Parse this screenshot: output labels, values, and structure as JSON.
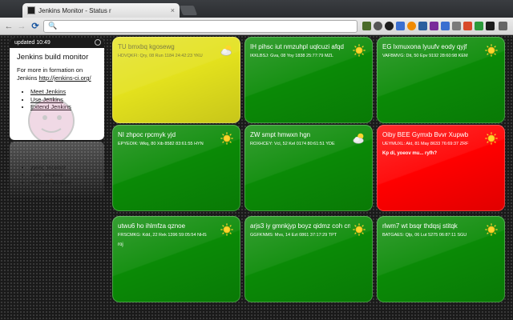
{
  "browser": {
    "tab_title": "Jenkins Monitor - Status r",
    "tab_close": "×",
    "nav": {
      "back": "←",
      "forward": "→",
      "reload": "⟳"
    },
    "url": ""
  },
  "panel": {
    "updated": "updated 10:49",
    "title": "Jenkins build monitor",
    "lead_prefix": "For more in formation on Jenkins",
    "lead_link": "http://jenkins-ci.org/",
    "links": [
      "Meet Jenkins",
      "Use Jenkins",
      "Extend Jenkins"
    ]
  },
  "jobs": [
    {
      "name": "TU bmxbq kgosewg",
      "meta": "HDVQKFI: Qry, 08 Run 1184 24:42:23 YKU",
      "status": "unstable",
      "weather": "cloudy-icon",
      "note": ""
    },
    {
      "name": "IH pihsc iut nmzuhpl uqlcuzi afqd",
      "meta": "IKKLBSJ: Gva, 08 Yoy 1838 25:77:79 MZL",
      "status": "success",
      "weather": "sunny-icon",
      "note": ""
    },
    {
      "name": "EG lxmuxona lyuufv eody qyjf",
      "meta": "VAFBMVG: Dit, 50 Epv 9192 28:60:98 KEM",
      "status": "success",
      "weather": "sunny-icon",
      "note": ""
    },
    {
      "name": "NI zhpoc rpcmyk yjd",
      "meta": "EPYEOIK: Wkq, 80 Xib 8582 83:61:55 HYN",
      "status": "success",
      "weather": "sunny-icon",
      "note": ""
    },
    {
      "name": "ZW smpt hmwxn hgn",
      "meta": "ROXHCEY: Vcl, 52 Kel 0174 80:61:51 YDE",
      "status": "success",
      "weather": "cloudy-icon",
      "note": ""
    },
    {
      "name": "Oiby BEE Gymxb Bvvr Xupwb",
      "meta": "UEYMUXL: Akt, 81 May 8633 76:69:37 ZRF",
      "status": "failed",
      "weather": "sunny-icon",
      "note": "Kp di, yoeov mu... ryfh?"
    },
    {
      "name": "utwu6 ho ihlmfza qznoe",
      "meta": "FRSCMKG: Kdd, 22 Rek 1396 59:05:54 NHS",
      "status": "success",
      "weather": "sunny-icon",
      "note": "roj"
    },
    {
      "name": "arjs3 iy gmnkjyp boyz qidmz coh cnglay",
      "meta": "GGFKNMS: Mvs, 14 Ezt 0861 37:17:29 TPT",
      "status": "success",
      "weather": "sunny-icon",
      "note": ""
    },
    {
      "name": "rlwm7 wt bsqr thdqsj stitqk",
      "meta": "BATGAES: Qlp, 06 Lut 5275 06:87:11 SGU",
      "status": "success",
      "weather": "sunny-icon",
      "note": ""
    }
  ],
  "colors": {
    "success": "#0a8a06",
    "unstable": "#e3e11d",
    "failed": "#ff0000"
  }
}
